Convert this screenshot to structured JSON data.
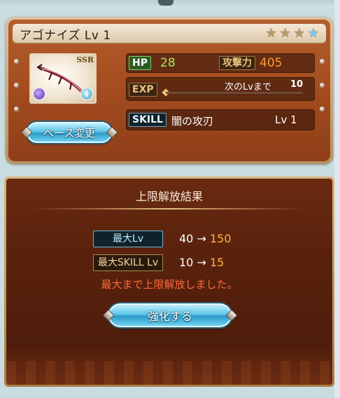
{
  "card": {
    "name": "アゴナイズ Lv 1",
    "stars": [
      {
        "icon": "star-icon",
        "glyph": "★",
        "color": "#b99a6a"
      },
      {
        "icon": "star-icon",
        "glyph": "★",
        "color": "#b99a6a"
      },
      {
        "icon": "star-icon",
        "glyph": "★",
        "color": "#b99a6a"
      },
      {
        "icon": "star-icon",
        "glyph": "★",
        "color": "#7cc7f0"
      }
    ],
    "rarity": "SSR",
    "info_glyph": "i",
    "hp_label": "HP",
    "hp_value": "28",
    "atk_label": "攻撃力",
    "atk_value": "405",
    "exp_label": "EXP",
    "exp_next_text": "次のLvまで",
    "exp_next_value": "10",
    "exp_progress": 0.0,
    "skill_label": "SKILL",
    "skill_name": "闇の攻刃",
    "skill_level": "Lv 1",
    "base_change_button": "ベース変更"
  },
  "result": {
    "title": "上限解放結果",
    "max_lv_label": "最大Lv",
    "max_lv_from": "40",
    "max_lv_arrow": "→",
    "max_lv_to": "150",
    "max_skill_label": "最大SKILL Lv",
    "max_skill_from": "10",
    "max_skill_arrow": "→",
    "max_skill_to": "15",
    "notice": "最大まで上限解放しました。",
    "enhance_button": "強化する"
  },
  "colors": {
    "hp_value": "#a6e85c",
    "atk_value": "#ff9a3c",
    "notice": "#ff6a3a",
    "upgrade_value": "#ffb347",
    "button_blue": "#5ec6ea"
  }
}
